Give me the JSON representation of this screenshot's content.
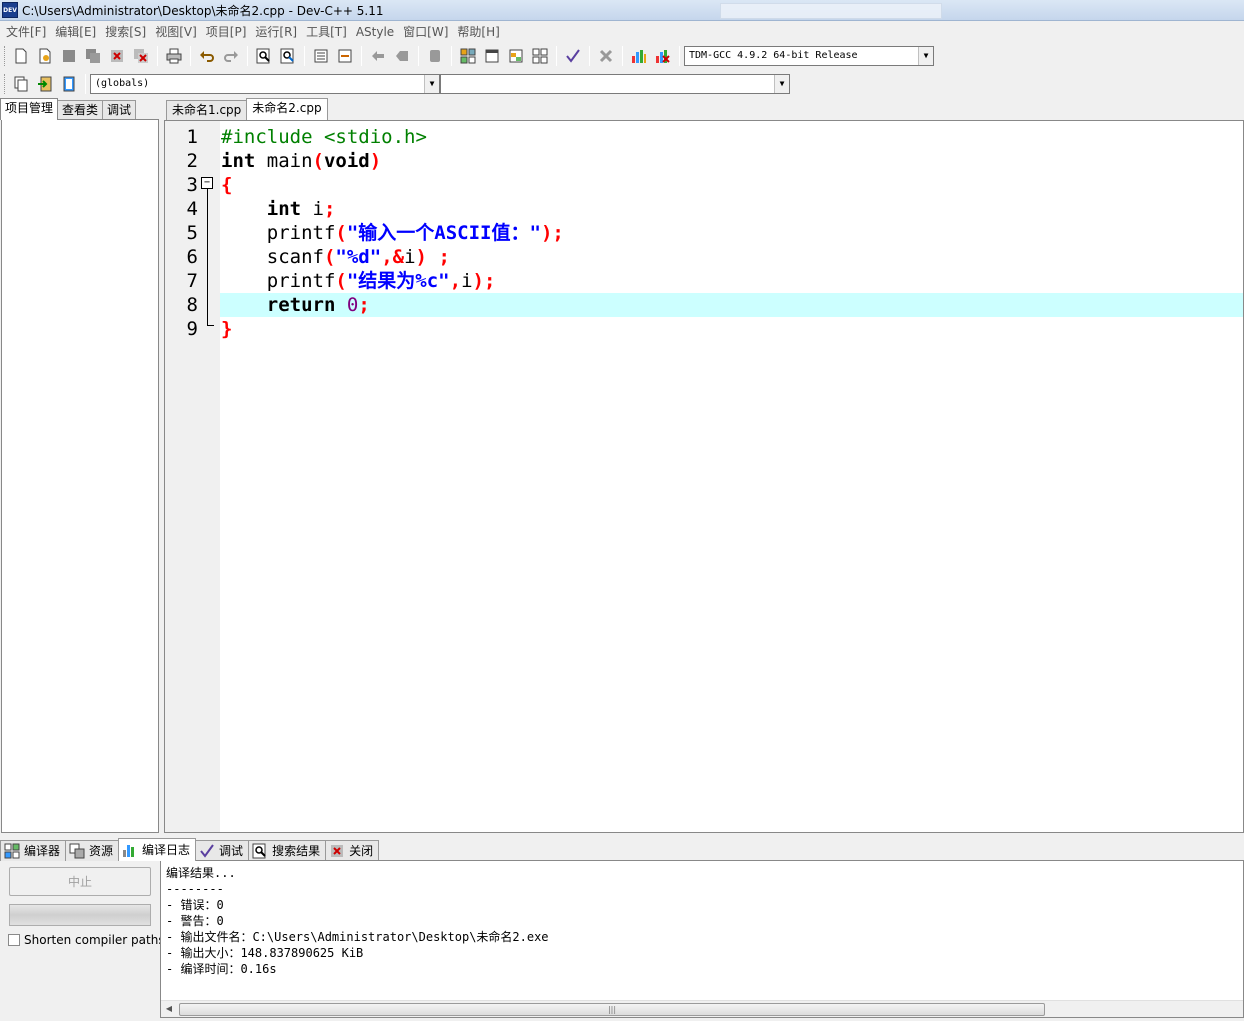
{
  "window": {
    "title": "C:\\Users\\Administrator\\Desktop\\未命名2.cpp - Dev-C++ 5.11",
    "app_icon_text": "DEV"
  },
  "menu": [
    "文件[F]",
    "编辑[E]",
    "搜索[S]",
    "视图[V]",
    "项目[P]",
    "运行[R]",
    "工具[T]",
    "AStyle",
    "窗口[W]",
    "帮助[H]"
  ],
  "toolbar": {
    "compiler_select": "TDM-GCC 4.9.2 64-bit Release",
    "scope_select": "(globals)",
    "member_select": ""
  },
  "left_tabs": [
    "项目管理",
    "查看类",
    "调试"
  ],
  "editor_tabs": [
    "未命名1.cpp",
    "未命名2.cpp"
  ],
  "code": {
    "line_numbers": [
      "1",
      "2",
      "3",
      "4",
      "5",
      "6",
      "7",
      "8",
      "9"
    ],
    "highlighted_line": 8,
    "lines": {
      "l1": {
        "pp": "#include <stdio.h>"
      },
      "l2": {
        "kw1": "int",
        "t1": " main",
        "p1": "(",
        "kw2": "void",
        "p2": ")"
      },
      "l3": {
        "brace": "{"
      },
      "l4": {
        "indent": "    ",
        "kw": "int",
        "t": " i",
        "semi": ";"
      },
      "l5": {
        "indent": "    ",
        "fn": "printf",
        "p1": "(",
        "str": "\"输入一个ASCII值：\"",
        "p2": ");"
      },
      "l6": {
        "indent": "    ",
        "fn": "scanf",
        "p1": "(",
        "str": "\"%d\"",
        "c": ",",
        "amp": "&",
        "v": "i",
        "p2": ")",
        "space": " ",
        "semi": ";"
      },
      "l7": {
        "indent": "    ",
        "fn": "printf",
        "p1": "(",
        "str": "\"结果为%c\"",
        "c": ",",
        "v": "i",
        "p2": ");"
      },
      "l8": {
        "indent": "    ",
        "kw": "return",
        "sp": " ",
        "num": "0",
        "semi": ";"
      },
      "l9": {
        "brace": "}"
      }
    }
  },
  "bottom_tabs": [
    "编译器",
    "资源",
    "编译日志",
    "调试",
    "搜索结果",
    "关闭"
  ],
  "bottom_active_tab": "编译日志",
  "compile_panel": {
    "abort_label": "中止",
    "shorten_paths_label": "Shorten compiler paths",
    "shorten_paths_checked": false,
    "log": [
      "编译结果...",
      "--------",
      "- 错误：0",
      "- 警告：0",
      "- 输出文件名：C:\\Users\\Administrator\\Desktop\\未命名2.exe",
      "- 输出大小：148.837890625 KiB",
      "- 编译时间：0.16s"
    ]
  },
  "colors": {
    "keyword": "#000000",
    "preprocessor": "#008000",
    "string": "#0000ff",
    "symbol": "#ff0000",
    "number": "#800080",
    "current_line": "#ccffff"
  }
}
